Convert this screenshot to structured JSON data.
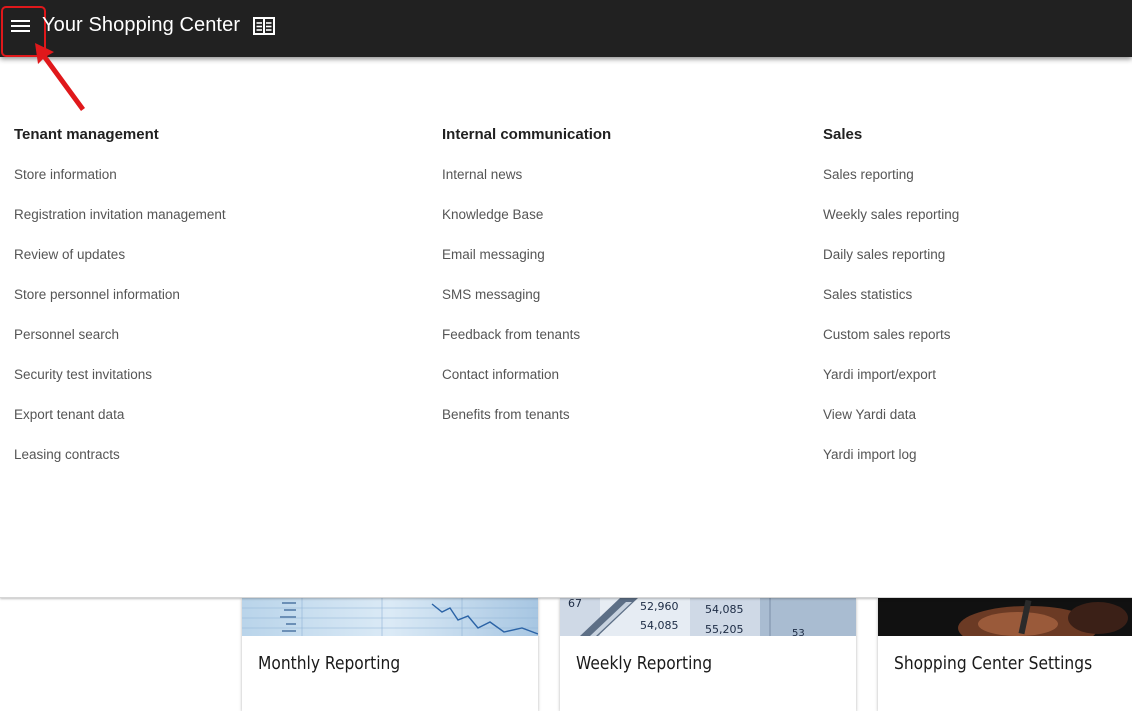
{
  "header": {
    "title": "Your Shopping Center",
    "menu_icon": "hamburger-menu-icon",
    "book_icon": "book-icon",
    "background": "#212121"
  },
  "annotation": {
    "highlight_color": "#e0181b"
  },
  "mega_menu": {
    "columns": [
      {
        "heading": "Tenant management",
        "items": [
          "Store information",
          "Registration invitation management",
          "Review of updates",
          "Store personnel information",
          "Personnel search",
          "Security test invitations",
          "Export tenant data",
          "Leasing contracts"
        ]
      },
      {
        "heading": "Internal communication",
        "items": [
          "Internal news",
          "Knowledge Base",
          "Email messaging",
          "SMS messaging",
          "Feedback from tenants",
          "Contact information",
          "Benefits from tenants"
        ]
      },
      {
        "heading": "Sales",
        "items": [
          "Sales reporting",
          "Weekly sales reporting",
          "Daily sales reporting",
          "Sales statistics",
          "Custom sales reports",
          "Yardi import/export",
          "View Yardi data",
          "Yardi import log"
        ]
      }
    ]
  },
  "cards": [
    {
      "title": "Monthly Reporting"
    },
    {
      "title": "Weekly Reporting",
      "image_numbers": [
        "67",
        "52,960",
        "54,085",
        "54,085",
        "55,205",
        "53"
      ]
    },
    {
      "title": "Shopping Center Settings"
    }
  ]
}
